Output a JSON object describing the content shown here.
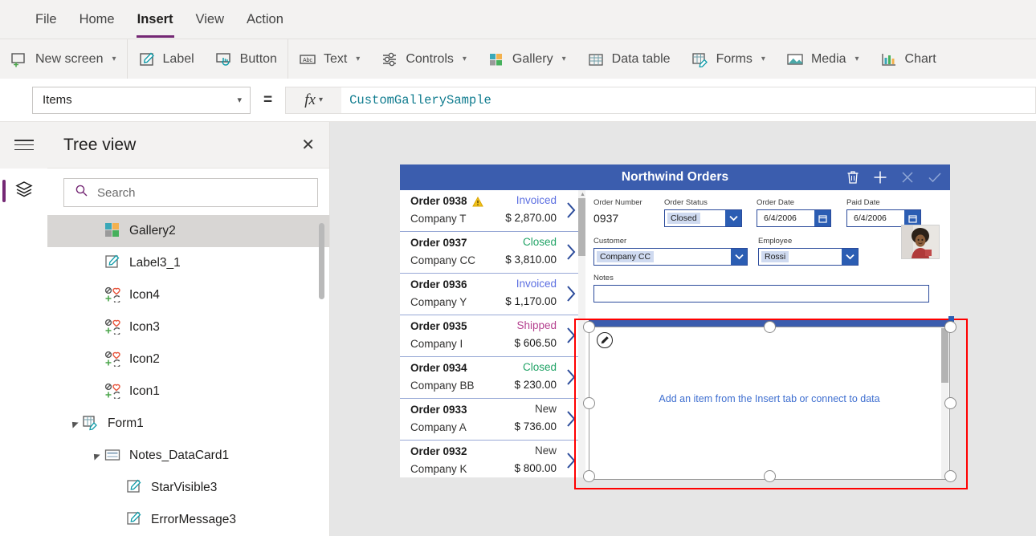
{
  "menu": {
    "items": [
      {
        "label": "File",
        "active": false
      },
      {
        "label": "Home",
        "active": false
      },
      {
        "label": "Insert",
        "active": true
      },
      {
        "label": "View",
        "active": false
      },
      {
        "label": "Action",
        "active": false
      }
    ]
  },
  "ribbon": {
    "items": [
      {
        "label": "New screen",
        "icon": "new-screen-icon",
        "caret": true
      },
      {
        "label": "Label",
        "icon": "label-icon",
        "caret": false
      },
      {
        "label": "Button",
        "icon": "button-icon",
        "caret": false
      },
      {
        "label": "Text",
        "icon": "text-icon",
        "caret": true
      },
      {
        "label": "Controls",
        "icon": "controls-icon",
        "caret": true
      },
      {
        "label": "Gallery",
        "icon": "gallery-icon",
        "caret": true
      },
      {
        "label": "Data table",
        "icon": "data-table-icon",
        "caret": false
      },
      {
        "label": "Forms",
        "icon": "forms-icon",
        "caret": true
      },
      {
        "label": "Media",
        "icon": "media-icon",
        "caret": true
      },
      {
        "label": "Chart",
        "icon": "chart-icon",
        "caret": false
      }
    ]
  },
  "formula_bar": {
    "property": "Items",
    "equals": "=",
    "fx_label": "fx",
    "formula": "CustomGallerySample"
  },
  "rail": {
    "hamburger": "hamburger-icon",
    "tree_view_button": "layers-icon"
  },
  "tree_panel": {
    "title": "Tree view",
    "close": "✕",
    "search_placeholder": "Search",
    "nodes": [
      {
        "label": "Gallery2",
        "icon": "gallery-icon",
        "indent": 1,
        "twisty": "",
        "selected": true
      },
      {
        "label": "Label3_1",
        "icon": "label-icon",
        "indent": 1,
        "twisty": "",
        "selected": false
      },
      {
        "label": "Icon4",
        "icon": "icon-set-icon",
        "indent": 1,
        "twisty": "",
        "selected": false
      },
      {
        "label": "Icon3",
        "icon": "icon-set-icon",
        "indent": 1,
        "twisty": "",
        "selected": false
      },
      {
        "label": "Icon2",
        "icon": "icon-set-icon",
        "indent": 1,
        "twisty": "",
        "selected": false
      },
      {
        "label": "Icon1",
        "icon": "icon-set-icon",
        "indent": 1,
        "twisty": "",
        "selected": false
      },
      {
        "label": "Form1",
        "icon": "form-icon",
        "indent": 0,
        "twisty": "expanded",
        "selected": false
      },
      {
        "label": "Notes_DataCard1",
        "icon": "datacard-icon",
        "indent": 1,
        "twisty": "expanded",
        "selected": false
      },
      {
        "label": "StarVisible3",
        "icon": "label-icon",
        "indent": 2,
        "twisty": "",
        "selected": false
      },
      {
        "label": "ErrorMessage3",
        "icon": "label-icon",
        "indent": 2,
        "twisty": "",
        "selected": false
      }
    ]
  },
  "app": {
    "header": {
      "title": "Northwind Orders",
      "icons": [
        {
          "name": "trash-icon",
          "dim": false
        },
        {
          "name": "add-icon",
          "dim": false
        },
        {
          "name": "cancel-icon",
          "dim": true
        },
        {
          "name": "confirm-icon",
          "dim": true
        }
      ]
    },
    "gallery": {
      "items": [
        {
          "order": "Order 0938",
          "company": "Company T",
          "status": "Invoiced",
          "status_color": "#5b6ee1",
          "amount": "$ 2,870.00",
          "warning": true
        },
        {
          "order": "Order 0937",
          "company": "Company CC",
          "status": "Closed",
          "status_color": "#21a366",
          "amount": "$ 3,810.00",
          "warning": false
        },
        {
          "order": "Order 0936",
          "company": "Company Y",
          "status": "Invoiced",
          "status_color": "#5b6ee1",
          "amount": "$ 1,170.00",
          "warning": false
        },
        {
          "order": "Order 0935",
          "company": "Company I",
          "status": "Shipped",
          "status_color": "#b5418f",
          "amount": "$ 606.50",
          "warning": false
        },
        {
          "order": "Order 0934",
          "company": "Company BB",
          "status": "Closed",
          "status_color": "#21a366",
          "amount": "$ 230.00",
          "warning": false
        },
        {
          "order": "Order 0933",
          "company": "Company A",
          "status": "New",
          "status_color": "#3a3a3a",
          "amount": "$ 736.00",
          "warning": false
        },
        {
          "order": "Order 0932",
          "company": "Company K",
          "status": "New",
          "status_color": "#3a3a3a",
          "amount": "$ 800.00",
          "warning": false
        }
      ]
    },
    "form": {
      "order_number": {
        "label": "Order Number",
        "value": "0937"
      },
      "order_status": {
        "label": "Order Status",
        "value": "Closed"
      },
      "order_date": {
        "label": "Order Date",
        "value": "6/4/2006"
      },
      "paid_date": {
        "label": "Paid Date",
        "value": "6/4/2006"
      },
      "customer": {
        "label": "Customer",
        "value": "Company CC"
      },
      "employee": {
        "label": "Employee",
        "value": "Rossi"
      },
      "notes": {
        "label": "Notes",
        "value": ""
      }
    },
    "selected_control": {
      "empty_message": "Add an item from the Insert tab or connect to data",
      "badge": "pencil-icon"
    }
  },
  "colors": {
    "accent_purple": "#742774",
    "app_blue": "#3b5dae",
    "selection_red": "#ff0000",
    "formula_teal": "#107c8f"
  }
}
